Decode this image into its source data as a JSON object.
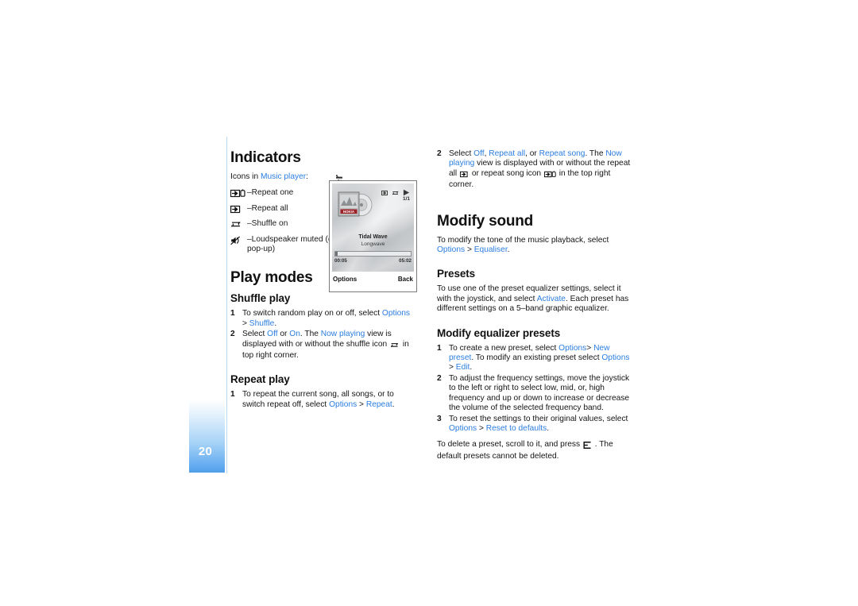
{
  "chapter": {
    "label": "Music player",
    "page_number": "20"
  },
  "left_column": {
    "indicators": {
      "heading": "Indicators",
      "intro_plain": "Icons in ",
      "intro_blue": "Music player",
      "intro_end": ":",
      "items": [
        {
          "icon": "repeat-one-icon",
          "label": "–Repeat one"
        },
        {
          "icon": "repeat-all-icon",
          "label": "–Repeat all"
        },
        {
          "icon": "shuffle-on-icon",
          "label": "–Shuffle on"
        },
        {
          "icon": "loudspeaker-muted-icon",
          "label": "–Loudspeaker muted (displayed in volume pop-up)"
        }
      ]
    },
    "play_modes": {
      "heading": "Play modes",
      "shuffle_play": {
        "heading": "Shuffle play",
        "steps": [
          {
            "num": "1",
            "parts": [
              {
                "t": "To switch random play on or off, select ",
                "c": "plain"
              },
              {
                "t": "Options",
                "c": "blue"
              },
              {
                "t": " > ",
                "c": "plain"
              },
              {
                "t": "Shuffle",
                "c": "blue"
              },
              {
                "t": ".",
                "c": "plain"
              }
            ]
          },
          {
            "num": "2",
            "parts": [
              {
                "t": "Select ",
                "c": "plain"
              },
              {
                "t": "Off",
                "c": "blue"
              },
              {
                "t": " or ",
                "c": "plain"
              },
              {
                "t": "On",
                "c": "blue"
              },
              {
                "t": ". The ",
                "c": "plain"
              },
              {
                "t": "Now playing",
                "c": "blue"
              },
              {
                "t": " view is displayed with or without the shuffle icon ",
                "c": "plain"
              },
              {
                "t": "[shuffle-on-icon]",
                "c": "icon"
              },
              {
                "t": " in top right corner.",
                "c": "plain"
              }
            ]
          }
        ]
      },
      "repeat_play": {
        "heading": "Repeat play",
        "steps": [
          {
            "num": "1",
            "parts": [
              {
                "t": "To repeat the current song, all songs, or to switch repeat off, select  ",
                "c": "plain"
              },
              {
                "t": "Options",
                "c": "blue"
              },
              {
                "t": " > ",
                "c": "plain"
              },
              {
                "t": "Repeat",
                "c": "blue"
              },
              {
                "t": ".",
                "c": "plain"
              }
            ]
          }
        ]
      }
    }
  },
  "right_column": {
    "repeat_step2": {
      "num": "2",
      "parts": [
        {
          "t": "Select ",
          "c": "plain"
        },
        {
          "t": "Off",
          "c": "blue"
        },
        {
          "t": ", ",
          "c": "plain"
        },
        {
          "t": "Repeat all",
          "c": "blue"
        },
        {
          "t": ", or ",
          "c": "plain"
        },
        {
          "t": "Repeat song",
          "c": "blue"
        },
        {
          "t": ". The ",
          "c": "plain"
        },
        {
          "t": "Now playing",
          "c": "blue"
        },
        {
          "t": " view is displayed with or without the repeat all ",
          "c": "plain"
        },
        {
          "t": "[repeat-all-icon]",
          "c": "icon"
        },
        {
          "t": " or repeat song icon ",
          "c": "plain"
        },
        {
          "t": "[repeat-one-icon]",
          "c": "icon"
        },
        {
          "t": " in the top right corner.",
          "c": "plain"
        }
      ]
    },
    "modify_sound": {
      "heading": "Modify sound",
      "intro_parts": [
        {
          "t": "To modify the tone of the music playback, select ",
          "c": "plain"
        },
        {
          "t": "Options",
          "c": "blue"
        },
        {
          "t": " > ",
          "c": "plain"
        },
        {
          "t": "Equaliser",
          "c": "blue"
        },
        {
          "t": ".",
          "c": "plain"
        }
      ]
    },
    "presets": {
      "heading": "Presets",
      "body_parts": [
        {
          "t": "To use one of the preset equalizer settings, select it with the joystick, and select ",
          "c": "plain"
        },
        {
          "t": "Activate",
          "c": "blue"
        },
        {
          "t": ". Each preset has different settings on a 5–band graphic equalizer.",
          "c": "plain"
        }
      ]
    },
    "modify_presets": {
      "heading": "Modify equalizer presets",
      "steps": [
        {
          "num": "1",
          "parts": [
            {
              "t": "To create a new preset, select ",
              "c": "plain"
            },
            {
              "t": "Options",
              "c": "blue"
            },
            {
              "t": "> ",
              "c": "plain"
            },
            {
              "t": "New preset",
              "c": "blue"
            },
            {
              "t": ". To modify an existing preset select ",
              "c": "plain"
            },
            {
              "t": "Options",
              "c": "blue"
            },
            {
              "t": " > ",
              "c": "plain"
            },
            {
              "t": "Edit",
              "c": "blue"
            },
            {
              "t": ".",
              "c": "plain"
            }
          ]
        },
        {
          "num": "2",
          "parts": [
            {
              "t": "To adjust the frequency settings, move the joystick to the left or right to select low, mid, or, high frequency and up or down to increase or decrease the volume of the selected frequency band.",
              "c": "plain"
            }
          ]
        },
        {
          "num": "3",
          "parts": [
            {
              "t": "To reset the settings to their original values, select ",
              "c": "plain"
            },
            {
              "t": "Options",
              "c": "blue"
            },
            {
              "t": " > ",
              "c": "plain"
            },
            {
              "t": "Reset to defaults",
              "c": "blue"
            },
            {
              "t": ".",
              "c": "plain"
            }
          ]
        }
      ],
      "footer_parts": [
        {
          "t": "To delete a preset, scroll to it, and press ",
          "c": "plain"
        },
        {
          "t": "[clear-key-icon]",
          "c": "icon"
        },
        {
          "t": " . The default presets cannot be deleted.",
          "c": "plain"
        }
      ]
    }
  },
  "phone_mock": {
    "name": "now-playing-screenshot",
    "status_icons": [
      "repeat-all-icon",
      "shuffle-on-icon",
      "play-icon"
    ],
    "track_count": "1/1",
    "album_art_label": "NOKIA",
    "track_title": "Tidal Wave",
    "track_artist": "Longwave",
    "elapsed_time": "00:05",
    "total_time": "05:02",
    "softkey_left": "Options",
    "softkey_right": "Back"
  },
  "colors": {
    "link_blue": "#2a7de1",
    "tab_blue": "#4f9fe8",
    "rule_blue": "#b9d9f2",
    "text": "#141414"
  }
}
